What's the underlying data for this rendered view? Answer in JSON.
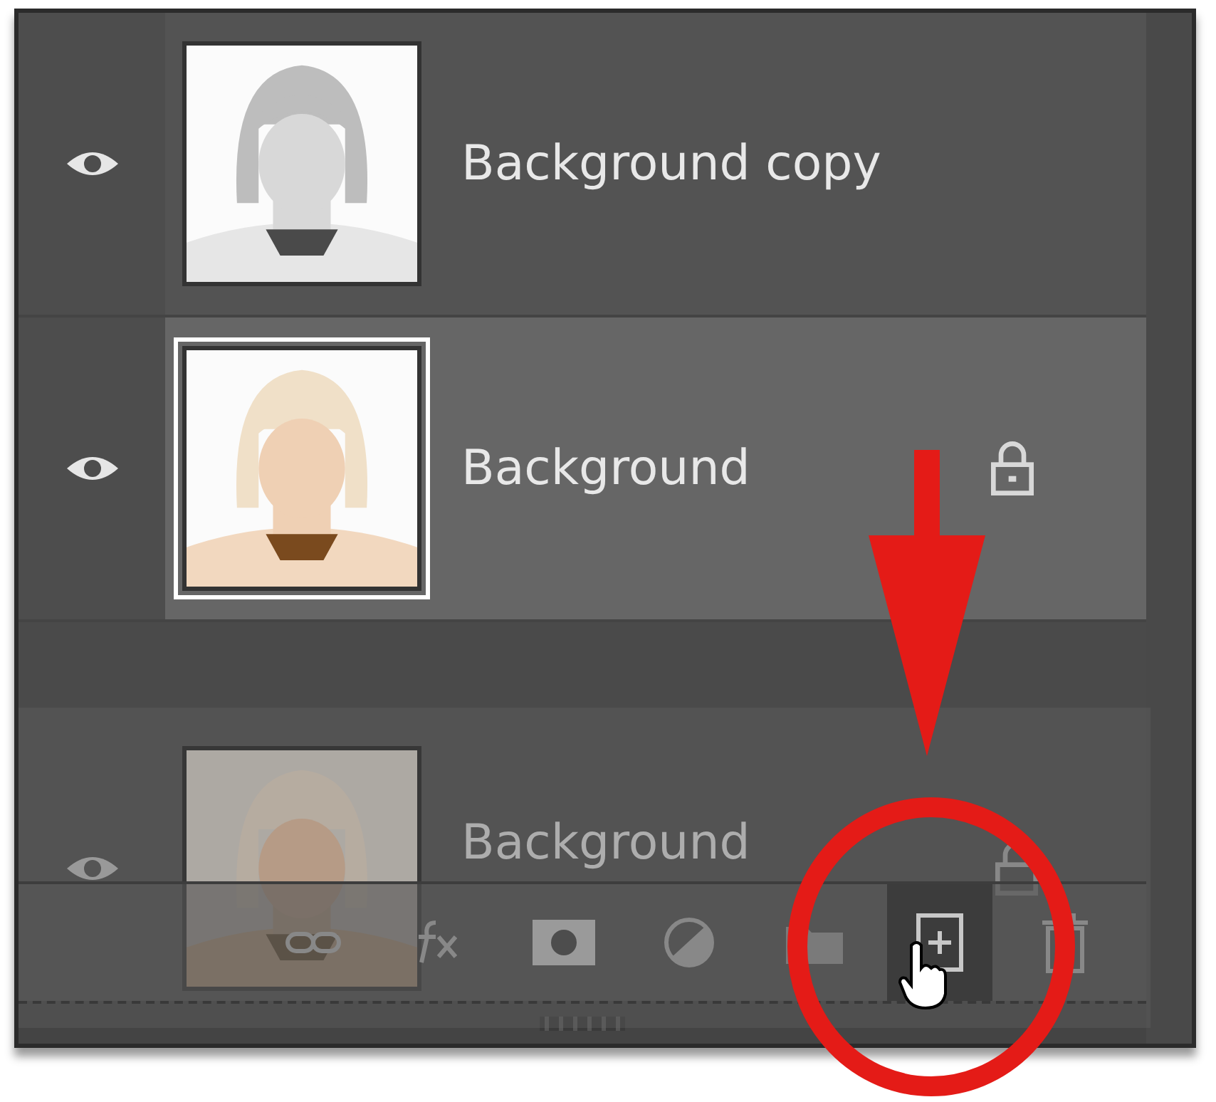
{
  "layers": [
    {
      "name": "Background copy",
      "visible": true,
      "selected": false,
      "locked": false,
      "grayscale": true
    },
    {
      "name": "Background",
      "visible": true,
      "selected": true,
      "locked": true,
      "grayscale": false
    }
  ],
  "dragged_layer": {
    "name": "Background",
    "visible": true,
    "locked": true,
    "grayscale": false
  },
  "toolbar": [
    {
      "kind": "link",
      "hovered": false
    },
    {
      "kind": "fx",
      "hovered": false
    },
    {
      "kind": "mask",
      "hovered": false
    },
    {
      "kind": "adjustment",
      "hovered": false
    },
    {
      "kind": "group",
      "hovered": false
    },
    {
      "kind": "new-layer",
      "hovered": true
    },
    {
      "kind": "trash",
      "hovered": false
    }
  ]
}
